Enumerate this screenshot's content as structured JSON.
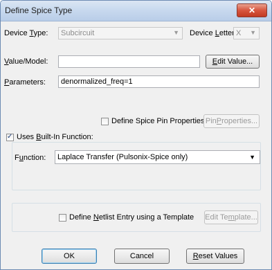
{
  "window": {
    "title": "Define Spice Type",
    "close_symbol": "✕"
  },
  "device_type": {
    "label_pre": "Device ",
    "label_key": "T",
    "label_post": "ype:",
    "value": "Subcircuit"
  },
  "device_letter": {
    "label_pre": "Device ",
    "label_key": "L",
    "label_post": "etter:",
    "value": "X"
  },
  "value_model": {
    "label_key": "V",
    "label_post": "alue/Model:",
    "value": "",
    "edit_button_key": "E",
    "edit_button_post": "dit Value..."
  },
  "parameters": {
    "label_key": "P",
    "label_post": "arameters:",
    "value": "denormalized_freq=1"
  },
  "pin_properties": {
    "checkbox_label": "Define Spice Pin Properties:",
    "checked": false,
    "button_pre": "Pin ",
    "button_key": "P",
    "button_post": "roperties..."
  },
  "built_in": {
    "checkbox_pre": "Uses ",
    "checkbox_key": "B",
    "checkbox_post": "uilt-In Function:",
    "checked": true,
    "function_pre": "F",
    "function_key": "u",
    "function_post": "nction:",
    "function_value": "Laplace Transfer (Pulsonix-Spice only)"
  },
  "netlist": {
    "checkbox_pre": "Define ",
    "checkbox_key": "N",
    "checkbox_post": "etlist Entry using a Template",
    "checked": false,
    "button_pre": "Edit Te",
    "button_key": "m",
    "button_post": "plate..."
  },
  "footer": {
    "ok": "OK",
    "cancel": "Cancel",
    "reset_key": "R",
    "reset_post": "eset Values"
  },
  "icons": {
    "dropdown_arrow": "▼"
  }
}
